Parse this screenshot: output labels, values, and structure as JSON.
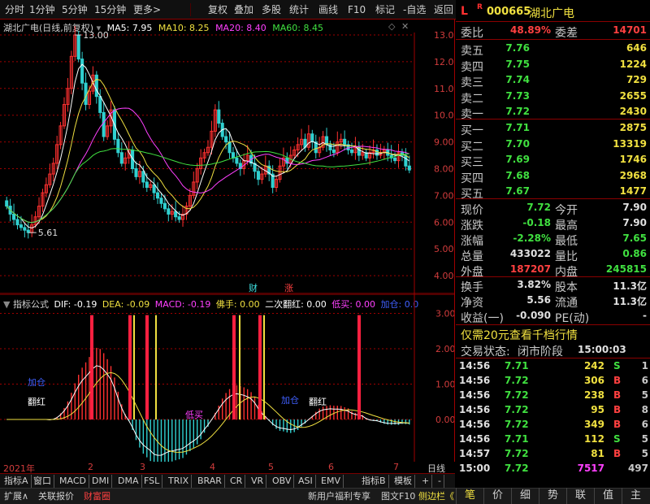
{
  "toolbar": {
    "items": [
      "分时",
      "1分钟",
      "5分钟",
      "15分钟",
      "更多>",
      "复权",
      "叠加",
      "多股",
      "统计",
      "画线",
      "F10",
      "标记",
      "-自选",
      "返回"
    ]
  },
  "main_chart": {
    "header": {
      "title": "湖北广电(日线,前复权)",
      "ma5_label": "MA5: 7.95",
      "ma10_label": "MA10: 8.25",
      "ma20_label": "MA20: 8.40",
      "ma60_label": "MA60: 8.45"
    },
    "y_ticks": [
      "13.00",
      "12.00",
      "11.00",
      "10.00",
      "9.00",
      "8.00",
      "7.00",
      "6.00",
      "5.00",
      "4.00"
    ],
    "high_marker": "13.00",
    "low_marker": "5.61",
    "event_tags": [
      "财",
      "涨"
    ]
  },
  "indicator": {
    "header": {
      "name": "指标公式",
      "dif": "DIF: -0.19",
      "dea": "DEA: -0.09",
      "macd": "MACD: -0.19",
      "foshou": "佛手: 0.00",
      "ercifanhong": "二次翻红: 0.00",
      "dimai": "低买: 0.00",
      "jiacang": "加仓: 0.0"
    },
    "y_ticks": [
      "3.00",
      "2.00",
      "1.00",
      "0.00"
    ],
    "annotations": [
      "加仓",
      "翻红",
      "低买",
      "加仓",
      "翻红"
    ]
  },
  "time_axis": {
    "year": "2021年",
    "months": [
      "2",
      "3",
      "4",
      "5",
      "6",
      "7"
    ],
    "period": "日线"
  },
  "indicator_tabs": [
    "指标A",
    "窗口",
    "MACD",
    "DMI",
    "DMA",
    "FSL",
    "TRIX",
    "BRAR",
    "CR",
    "VR",
    "OBV",
    "ASI",
    "EMV",
    "指标B",
    "模板",
    "+",
    "-"
  ],
  "status_bar": {
    "left": [
      "扩展∧",
      "关联报价",
      "财富圈"
    ],
    "right": [
      "新用户福利专享",
      "图文F10",
      "侧边栏《"
    ]
  },
  "quote": {
    "flags": [
      "L",
      "R"
    ],
    "code": "000665",
    "name": "湖北广电",
    "weibi_label": "委比",
    "weibi": "48.89%",
    "weicha_label": "委差",
    "weicha": "14701",
    "asks": [
      {
        "label": "卖五",
        "price": "7.76",
        "vol": "646"
      },
      {
        "label": "卖四",
        "price": "7.75",
        "vol": "1224"
      },
      {
        "label": "卖三",
        "price": "7.74",
        "vol": "729"
      },
      {
        "label": "卖二",
        "price": "7.73",
        "vol": "2655"
      },
      {
        "label": "卖一",
        "price": "7.72",
        "vol": "2430"
      }
    ],
    "bids": [
      {
        "label": "买一",
        "price": "7.71",
        "vol": "2875"
      },
      {
        "label": "买二",
        "price": "7.70",
        "vol": "13319"
      },
      {
        "label": "买三",
        "price": "7.69",
        "vol": "1746"
      },
      {
        "label": "买四",
        "price": "7.68",
        "vol": "2968"
      },
      {
        "label": "买五",
        "price": "7.67",
        "vol": "1477"
      }
    ],
    "stats": [
      {
        "l1": "现价",
        "v1": "7.72",
        "c1": "c-green",
        "l2": "今开",
        "v2": "7.90",
        "c2": "c-white"
      },
      {
        "l1": "涨跌",
        "v1": "-0.18",
        "c1": "c-green",
        "l2": "最高",
        "v2": "7.90",
        "c2": "c-white"
      },
      {
        "l1": "涨幅",
        "v1": "-2.28%",
        "c1": "c-green",
        "l2": "最低",
        "v2": "7.65",
        "c2": "c-green"
      },
      {
        "l1": "总量",
        "v1": "433022",
        "c1": "c-white",
        "l2": "量比",
        "v2": "0.86",
        "c2": "c-green"
      },
      {
        "l1": "外盘",
        "v1": "187207",
        "c1": "c-red",
        "l2": "内盘",
        "v2": "245815",
        "c2": "c-green"
      }
    ],
    "stats2": [
      {
        "l1": "换手",
        "v1": "3.82%",
        "l2": "股本",
        "v2": "11.3亿"
      },
      {
        "l1": "净资",
        "v1": "5.56",
        "l2": "流通",
        "v2": "11.3亿"
      },
      {
        "l1": "收益(一)",
        "v1": "-0.090",
        "l2": "PE(动)",
        "v2": "-"
      }
    ],
    "promo": "仅需20元查看千档行情",
    "trade_status_label": "交易状态:",
    "trade_status": "闭市阶段",
    "trade_time": "15:00:03"
  },
  "trades": [
    {
      "time": "14:56",
      "price": "7.71",
      "pc": "c-green",
      "vol": "242",
      "side": "S",
      "sc": "c-green",
      "n": "1"
    },
    {
      "time": "14:56",
      "price": "7.72",
      "pc": "c-green",
      "vol": "306",
      "side": "B",
      "sc": "c-red",
      "n": "6"
    },
    {
      "time": "14:56",
      "price": "7.72",
      "pc": "c-green",
      "vol": "238",
      "side": "B",
      "sc": "c-red",
      "n": "5"
    },
    {
      "time": "14:56",
      "price": "7.72",
      "pc": "c-green",
      "vol": "95",
      "side": "B",
      "sc": "c-red",
      "n": "8"
    },
    {
      "time": "14:56",
      "price": "7.72",
      "pc": "c-green",
      "vol": "349",
      "side": "B",
      "sc": "c-red",
      "n": "6"
    },
    {
      "time": "14:56",
      "price": "7.71",
      "pc": "c-green",
      "vol": "112",
      "side": "S",
      "sc": "c-green",
      "n": "5"
    },
    {
      "time": "14:57",
      "price": "7.72",
      "pc": "c-green",
      "vol": "81",
      "side": "B",
      "sc": "c-red",
      "n": "5"
    },
    {
      "time": "15:00",
      "price": "7.72",
      "pc": "c-green",
      "vol": "7517",
      "side": "",
      "sc": "c-red",
      "n": "497"
    }
  ],
  "bottom_nav": [
    "笔",
    "价",
    "细",
    "势",
    "联",
    "值",
    "主"
  ],
  "colors": {
    "up": "#ff3030",
    "down": "#30d0d0",
    "ma5": "#ffffff",
    "ma10": "#f0e040",
    "ma20": "#ff40ff",
    "ma60": "#40e040"
  }
}
